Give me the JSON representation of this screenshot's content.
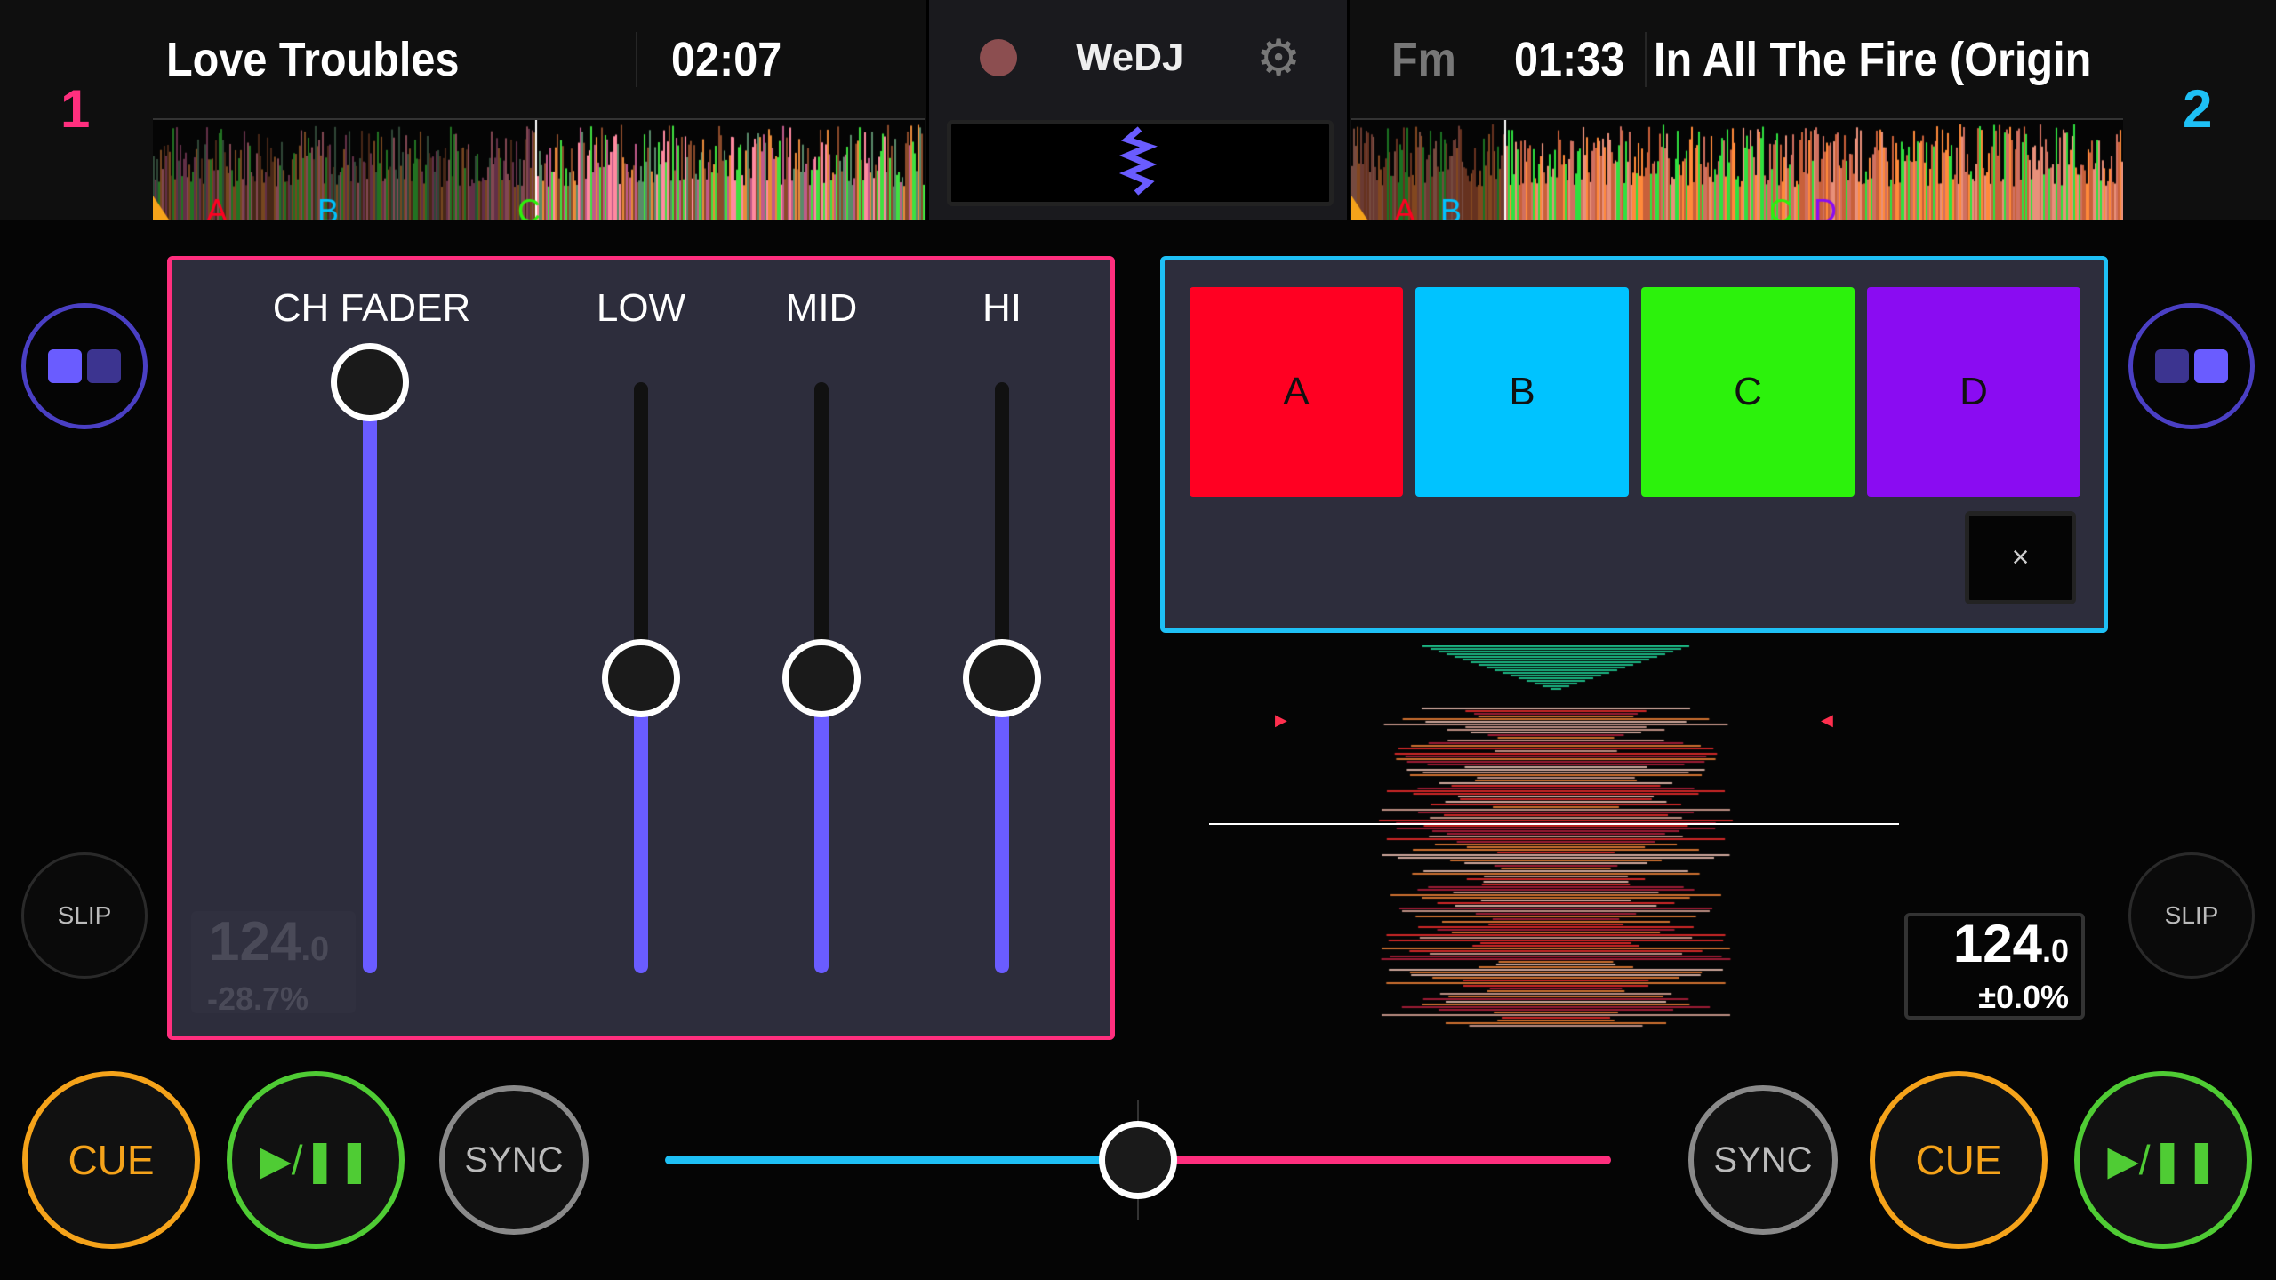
{
  "deck1": {
    "number": "1",
    "title": "Love Troubles",
    "time": "02:07",
    "cue_markers": [
      "A",
      "B",
      "C"
    ],
    "bpm": "124",
    "bpm_decimal": ".0",
    "pitch": "-28.7%"
  },
  "deck2": {
    "number": "2",
    "key": "Fm",
    "time": "01:33",
    "title": "In All The Fire (Origin",
    "cue_markers": [
      "A",
      "B",
      "C",
      "D"
    ],
    "bpm": "124",
    "bpm_decimal": ".0",
    "pitch": "±0.0%"
  },
  "app": {
    "logo": "WeDJ",
    "record_icon": "record-icon",
    "settings_icon": "gear-icon"
  },
  "mixer": {
    "labels": {
      "ch_fader": "CH FADER",
      "low": "LOW",
      "mid": "MID",
      "hi": "HI"
    },
    "ch_fader_level": 1.0,
    "low": 0.5,
    "mid": 0.5,
    "hi": 0.5
  },
  "hotcues": {
    "pads": [
      {
        "label": "A",
        "color": "#ff0022"
      },
      {
        "label": "B",
        "color": "#00c3ff"
      },
      {
        "label": "C",
        "color": "#2cf20c"
      },
      {
        "label": "D",
        "color": "#8a0cf2"
      }
    ],
    "close": "×"
  },
  "buttons": {
    "cue": "CUE",
    "play": "▶/❚❚",
    "sync": "SYNC",
    "slip": "SLIP"
  },
  "crossfader": {
    "position": 0.5
  },
  "colors": {
    "deck1": "#ff2f7e",
    "deck2": "#1ec0f5",
    "accent": "#6a5cff",
    "cue": "#f5a31a",
    "play": "#4fcc34"
  }
}
